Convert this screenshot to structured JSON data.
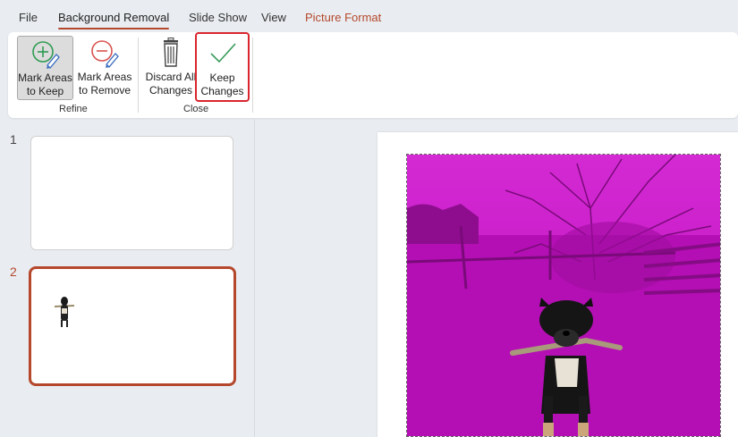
{
  "tabs": [
    {
      "label": "File"
    },
    {
      "label": "Background Removal"
    },
    {
      "label": "Slide Show"
    },
    {
      "label": "View"
    },
    {
      "label": "Picture Format"
    }
  ],
  "ribbon": {
    "mark_keep": {
      "line1": "Mark Areas",
      "line2": "to Keep"
    },
    "mark_remove": {
      "line1": "Mark Areas",
      "line2": "to Remove"
    },
    "discard": {
      "line1": "Discard All",
      "line2": "Changes"
    },
    "keep": {
      "line1": "Keep",
      "line2": "Changes"
    },
    "group_refine": "Refine",
    "group_close": "Close"
  },
  "slides": [
    {
      "number": "1"
    },
    {
      "number": "2"
    }
  ],
  "colors": {
    "accent": "#b5482c",
    "highlight": "#d9262e",
    "removal_overlay": "#c20fc2"
  }
}
